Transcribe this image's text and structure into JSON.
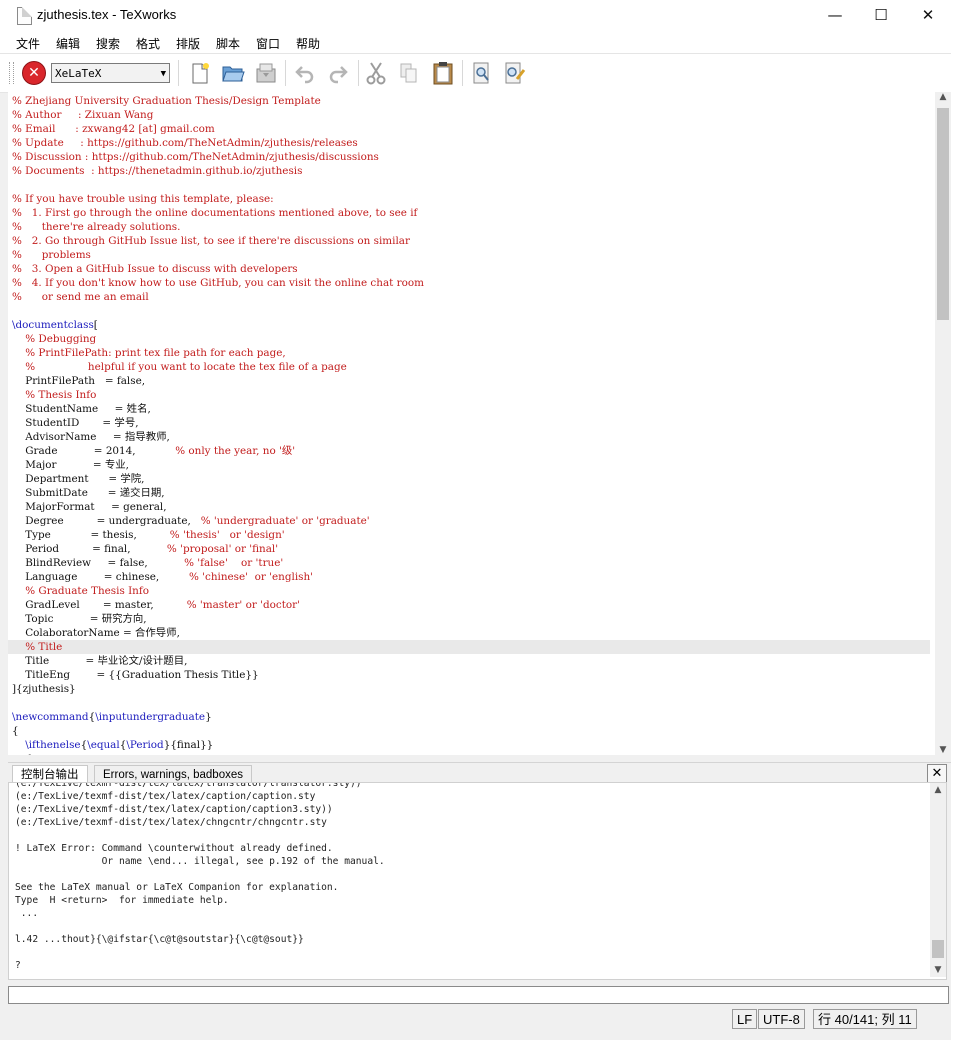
{
  "window": {
    "title": "zjuthesis.tex - TeXworks",
    "minimize": "—",
    "maximize": "☐",
    "close": "✕"
  },
  "menu": [
    "文件",
    "编辑",
    "搜索",
    "格式",
    "排版",
    "脚本",
    "窗口",
    "帮助"
  ],
  "toolbar": {
    "typeset_engine": "XeLaTeX",
    "stop_glyph": "✕",
    "engine_arrow": "▼"
  },
  "editor": {
    "lines": [
      {
        "t": "% Zhejiang University Graduation Thesis/Design Template",
        "s": "c"
      },
      {
        "t": "% Author     : Zixuan Wang",
        "s": "c"
      },
      {
        "t": "% Email      : zxwang42 [at] gmail.com",
        "s": "c"
      },
      {
        "t": "% Update     : https://github.com/TheNetAdmin/zjuthesis/releases",
        "s": "c"
      },
      {
        "t": "% Discussion : https://github.com/TheNetAdmin/zjuthesis/discussions",
        "s": "c"
      },
      {
        "t": "% Documents  : https://thenetadmin.github.io/zjuthesis",
        "s": "c"
      },
      {
        "t": "",
        "s": ""
      },
      {
        "t": "% If you have trouble using this template, please:",
        "s": "c"
      },
      {
        "t": "%   1. First go through the online documentations mentioned above, to see if",
        "s": "c"
      },
      {
        "t": "%      there're already solutions.",
        "s": "c"
      },
      {
        "t": "%   2. Go through GitHub Issue list, to see if there're discussions on similar",
        "s": "c"
      },
      {
        "t": "%      problems",
        "s": "c"
      },
      {
        "t": "%   3. Open a GitHub Issue to discuss with developers",
        "s": "c"
      },
      {
        "t": "%   4. If you don't know how to use GitHub, you can visit the online chat room",
        "s": "c"
      },
      {
        "t": "%      or send me an email",
        "s": "c"
      },
      {
        "t": "",
        "s": ""
      },
      {
        "p": [
          {
            "t": "\\documentclass",
            "s": "k"
          },
          {
            "t": "[",
            "s": ""
          }
        ]
      },
      {
        "t": "    % Debugging",
        "s": "c"
      },
      {
        "t": "    % PrintFilePath: print tex file path for each page,",
        "s": "c"
      },
      {
        "t": "    %                helpful if you want to locate the tex file of a page",
        "s": "c"
      },
      {
        "t": "    PrintFilePath   = false,",
        "s": ""
      },
      {
        "t": "    % Thesis Info",
        "s": "c"
      },
      {
        "t": "    StudentName     = 姓名,",
        "s": ""
      },
      {
        "t": "    StudentID       = 学号,",
        "s": ""
      },
      {
        "t": "    AdvisorName     = 指导教师,",
        "s": ""
      },
      {
        "p": [
          {
            "t": "    Grade           = 2014,            ",
            "s": ""
          },
          {
            "t": "% only the year, no '级'",
            "s": "c"
          }
        ]
      },
      {
        "t": "    Major           = 专业,",
        "s": ""
      },
      {
        "t": "    Department      = 学院,",
        "s": ""
      },
      {
        "t": "    SubmitDate      = 递交日期,",
        "s": ""
      },
      {
        "t": "    MajorFormat     = general,",
        "s": ""
      },
      {
        "p": [
          {
            "t": "    Degree          = undergraduate,   ",
            "s": ""
          },
          {
            "t": "% 'undergraduate' or 'graduate'",
            "s": "c"
          }
        ]
      },
      {
        "p": [
          {
            "t": "    Type            = thesis,          ",
            "s": ""
          },
          {
            "t": "% 'thesis'   or 'design'",
            "s": "c"
          }
        ]
      },
      {
        "p": [
          {
            "t": "    Period          = final,           ",
            "s": ""
          },
          {
            "t": "% 'proposal' or 'final'",
            "s": "c"
          }
        ]
      },
      {
        "p": [
          {
            "t": "    BlindReview     = false,           ",
            "s": ""
          },
          {
            "t": "% 'false'    or 'true'",
            "s": "c"
          }
        ]
      },
      {
        "p": [
          {
            "t": "    Language        = chinese,         ",
            "s": ""
          },
          {
            "t": "% 'chinese'  or 'english'",
            "s": "c"
          }
        ]
      },
      {
        "t": "    % Graduate Thesis Info",
        "s": "c"
      },
      {
        "p": [
          {
            "t": "    GradLevel       = master,          ",
            "s": ""
          },
          {
            "t": "% 'master' or 'doctor'",
            "s": "c"
          }
        ]
      },
      {
        "t": "    Topic           = 研究方向,",
        "s": ""
      },
      {
        "t": "    ColaboratorName = 合作导师,",
        "s": ""
      },
      {
        "t": "    % Title",
        "s": "c",
        "cur": true
      },
      {
        "t": "    Title           = 毕业论文/设计题目,",
        "s": ""
      },
      {
        "t": "    TitleEng        = {{Graduation Thesis Title}}",
        "s": ""
      },
      {
        "t": "]{zjuthesis}",
        "s": ""
      },
      {
        "t": "",
        "s": ""
      },
      {
        "p": [
          {
            "t": "\\newcommand",
            "s": "k"
          },
          {
            "t": "{",
            "s": ""
          },
          {
            "t": "\\inputundergraduate",
            "s": "k"
          },
          {
            "t": "}",
            "s": ""
          }
        ]
      },
      {
        "t": "{",
        "s": ""
      },
      {
        "p": [
          {
            "t": "    ",
            "s": ""
          },
          {
            "t": "\\ifthenelse",
            "s": "k"
          },
          {
            "t": "{",
            "s": ""
          },
          {
            "t": "\\equal",
            "s": "k"
          },
          {
            "t": "{",
            "s": ""
          },
          {
            "t": "\\Period",
            "s": "k"
          },
          {
            "t": "}{final}}",
            "s": ""
          }
        ]
      },
      {
        "t": "    {",
        "s": ""
      }
    ]
  },
  "console": {
    "tabs": [
      "控制台输出",
      "Errors, warnings, badboxes"
    ],
    "close": "✕",
    "log": [
      "(e:/TexLive/texmf-dist/tex/latex/translator/translator.sty))",
      "(e:/TexLive/texmf-dist/tex/latex/caption/caption.sty",
      "(e:/TexLive/texmf-dist/tex/latex/caption/caption3.sty))",
      "(e:/TexLive/texmf-dist/tex/latex/chngcntr/chngcntr.sty",
      "",
      "! LaTeX Error: Command \\counterwithout already defined.",
      "               Or name \\end... illegal, see p.192 of the manual.",
      "",
      "See the LaTeX manual or LaTeX Companion for explanation.",
      "Type  H <return>  for immediate help.",
      " ...",
      "",
      "l.42 ...thout}{\\@ifstar{\\c@t@soutstar}{\\c@t@sout}}",
      "",
      "?"
    ]
  },
  "status": {
    "line_ending": "LF",
    "encoding": "UTF-8",
    "position": "行 40/141; 列 11"
  }
}
